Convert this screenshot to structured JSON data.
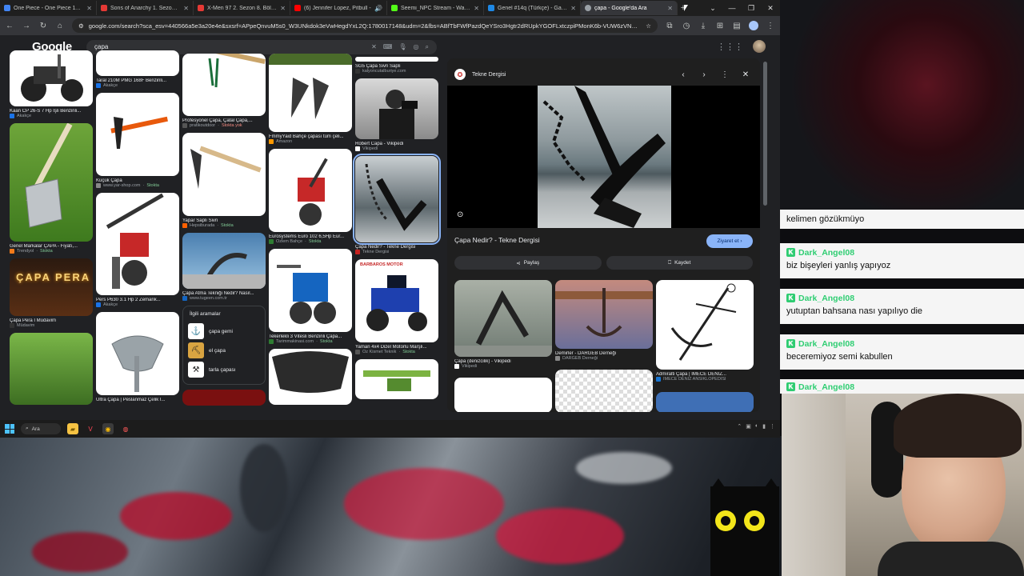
{
  "browser": {
    "tabs": [
      {
        "label": "One Piece - One Piece 1189 - Tü",
        "color": "#4285f4"
      },
      {
        "label": "Sons of Anarchy 1. Sezon 1. Bölü",
        "color": "#e53935"
      },
      {
        "label": "X-Men 97 2. Sezon 8. Bölüm izle",
        "color": "#e53935"
      },
      {
        "label": "(6) Jennifer Lopez, Pitbull - ",
        "color": "#ff0000"
      },
      {
        "label": "Seemi_NPC Stream - Watch Liv",
        "color": "#53fc18"
      },
      {
        "label": "Genel #14q (Türkçe) - Gartic.io",
        "color": "#1e88e5"
      },
      {
        "label": "çapa - Google'da Ara",
        "color": "#9aa0a6"
      }
    ],
    "url": "google.com/search?sca_esv=440566a5e3a20e4e&sxsrf=APpeQnvuM5s0_W3UNkdok3eVwHegdYxL2Q:1780017148&udm=2&fbs=ABfTbFWfPazdQeYSro3Hgtr2dRUpkYGOFLxtczpiPMonK6b-VUW6zVNCIvOjXud..."
  },
  "google": {
    "logo": "Google",
    "query": "çapa"
  },
  "results": {
    "col1": [
      {
        "title": "Kaan CP 26-S 7 Hp İşli Benzinli...",
        "source": "Akakçe",
        "stock": ""
      },
      {
        "title": "Genel Markalar ÇAPA - Fiyatı,...",
        "source": "Trendyol",
        "stock": "Stokta"
      },
      {
        "title": "Çapa Pera I Müdavim",
        "source": "Müdavim",
        "stock": ""
      },
      {
        "title": "",
        "source": "",
        "stock": ""
      }
    ],
    "col2": [
      {
        "title": "Taral 210M PMG 168F Benzinli...",
        "source": "Akakçe",
        "stock": ""
      },
      {
        "title": "Küçük Çapa",
        "source": "www.yar-shop.com",
        "stock": "Stokta"
      },
      {
        "title": "Pers P630 3.1 Hp 2 Zemank...",
        "source": "Akakçe",
        "stock": ""
      },
      {
        "title": "Ultra Çapa | Peslanmaz Çelik İ...",
        "source": "",
        "stock": ""
      }
    ],
    "col3": [
      {
        "title": "Profesyonel Çapa, Çatal Çapa,...",
        "source": "pratikoutdoor",
        "stock": "Stokta yok"
      },
      {
        "title": "Yapar Saplı Sivri",
        "source": "Hepsiburada",
        "stock": "Stokta"
      },
      {
        "title": "Çapa Atma Tekniği Nedir? Nasıl...",
        "source": "www.tugeen.com.tr",
        "stock": ""
      }
    ],
    "related": {
      "heading": "İlgili aramalar",
      "items": [
        "çapa gemi",
        "el çapa",
        "tarla çapası"
      ]
    },
    "col4": [
      {
        "title": "FmmyYaid Bahçe çapası tüm çeli...",
        "source": "Amazon",
        "stock": ""
      },
      {
        "title": "Eurosystems Euro 102 6,5Hp Eur...",
        "source": "Özlem Bahçe",
        "stock": "Stokta"
      },
      {
        "title": "Tekerlekli 3 Vitesli Benzinli Çapa...",
        "source": "Tarimmakinasi.com",
        "stock": "Stokta"
      },
      {
        "title": "",
        "source": "",
        "stock": ""
      }
    ],
    "col5": [
      {
        "title": "SG5 Çapa Sivri Saplı",
        "source": "kalyoncutalburiye.com",
        "stock": ""
      },
      {
        "title": "Robert Capa - Vikipedi",
        "source": "Vikipedi",
        "stock": ""
      },
      {
        "title": "Çapa Nedir? - Tekne Dergisi",
        "source": "Tekne Dergisi",
        "stock": ""
      },
      {
        "title": "Yaman 4x4 Dizel Motorlu Marşlı...",
        "source": "Oz Kismet Teknik",
        "stock": "Stokta"
      },
      {
        "title": "",
        "source": "",
        "stock": ""
      }
    ],
    "barbaros_label": "BARBAROS MOTOR"
  },
  "panel": {
    "source": "Tekne Dergisi",
    "title": "Çapa Nedir? - Tekne Dergisi",
    "visit": "Ziyaret et",
    "share": "Paylaş",
    "save": "Kaydet",
    "related": [
      {
        "title": "Çapa (denizcilik) - Vikipedi",
        "source": "Vikipedi"
      },
      {
        "title": "Demirler - DARGEB Derneği",
        "source": "DARGEB Derneği"
      },
      {
        "title": "Admiralti Çapa | İMECE DENİZ...",
        "source": "İMECE DENİZ ANSİKLOPEDİSİ"
      }
    ]
  },
  "taskbar": {
    "search": "Ara"
  },
  "chat": {
    "messages": [
      {
        "user": "",
        "text": "kelimen gözükmüyo"
      },
      {
        "user": "Dark_Angel08",
        "text": "biz bişeyleri yanlış yapıyoz"
      },
      {
        "user": "Dark_Angel08",
        "text": "yutuptan bahsana nası yapılıyo die"
      },
      {
        "user": "Dark_Angel08",
        "text": "beceremiyoz semi kabullen"
      },
      {
        "user": "Dark_Angel08",
        "text": ""
      }
    ]
  },
  "colors": {
    "accent": "#8ab4f8",
    "chat_user": "#2ecc71",
    "stock": "#81c995"
  }
}
